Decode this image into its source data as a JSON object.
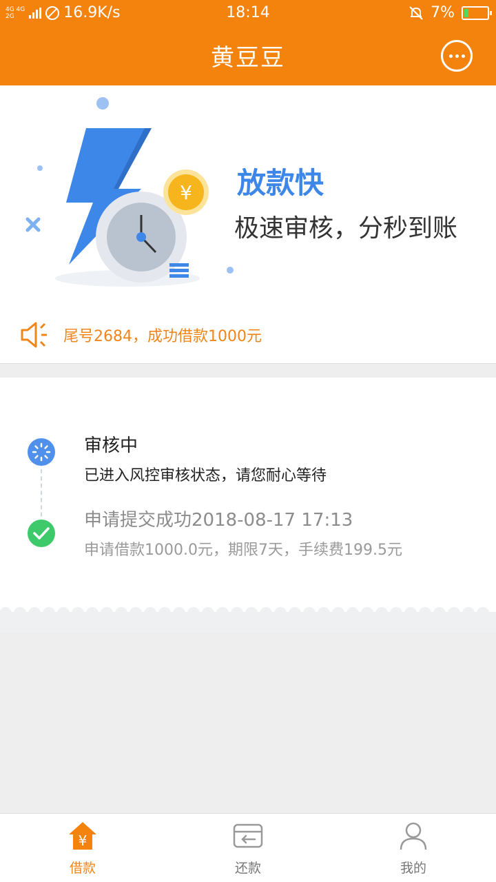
{
  "status_bar": {
    "network_top": "4G 4G",
    "network_bottom": "2G",
    "speed": "16.9K/s",
    "time": "18:14",
    "battery": "7%"
  },
  "header": {
    "title": "黄豆豆",
    "chat_icon": "chat-bubble-icon"
  },
  "hero": {
    "title": "放款快",
    "subtitle": "极速审核，分秒到账",
    "notice": "尾号2684，成功借款1000元",
    "yen_symbol": "¥"
  },
  "timeline": [
    {
      "title": "审核中",
      "desc": "已进入风控审核状态，请您耐心等待",
      "icon": "loading-icon",
      "color": "#4e90ea"
    },
    {
      "title": "申请提交成功2018-08-17 17:13",
      "desc": "申请借款1000.0元，期限7天，手续费199.5元",
      "icon": "check-icon",
      "color": "#3ec96a"
    }
  ],
  "bottom_nav": [
    {
      "label": "借款",
      "icon": "loan-house-icon",
      "active": true
    },
    {
      "label": "还款",
      "icon": "repay-card-icon",
      "active": false
    },
    {
      "label": "我的",
      "icon": "user-icon",
      "active": false
    }
  ],
  "colors": {
    "brand": "#f4830e",
    "accent_blue": "#3d87e8",
    "notice_orange": "#f08519",
    "success_green": "#3ec96a"
  }
}
